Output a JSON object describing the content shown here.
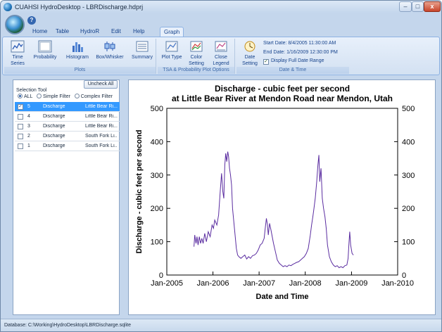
{
  "window": {
    "title": "CUAHSI HydroDesktop - LBRDischarge.hdprj"
  },
  "titlebar_buttons": {
    "minimize": "–",
    "maximize": "□",
    "close": "x"
  },
  "quick_access": {
    "help": "?"
  },
  "tabs": [
    {
      "label": "Home"
    },
    {
      "label": "Table"
    },
    {
      "label": "HydroR"
    },
    {
      "label": "Edit"
    },
    {
      "label": "Help"
    },
    {
      "label": "Graph",
      "active": true
    }
  ],
  "ribbon": {
    "plots_group": {
      "label": "Plots",
      "buttons": [
        {
          "label": "Time Series",
          "icon": "time-series-icon"
        },
        {
          "label": "Probability",
          "icon": "probability-icon"
        },
        {
          "label": "Histogram",
          "icon": "histogram-icon"
        },
        {
          "label": "Box/Whisker",
          "icon": "box-whisker-icon"
        },
        {
          "label": "Summary",
          "icon": "summary-icon"
        }
      ]
    },
    "options_group": {
      "label": "TSA & Probability Plot Options",
      "buttons": [
        {
          "label": "Plot Type",
          "icon": "plot-type-icon"
        },
        {
          "label": "Color Setting",
          "icon": "color-setting-icon"
        },
        {
          "label": "Close Legend",
          "icon": "close-legend-icon"
        }
      ]
    },
    "date_group": {
      "label": "Date & Time",
      "button": {
        "label": "Date Setting",
        "icon": "date-setting-icon"
      },
      "start_date": "Start Date: 8/4/2005 11:30:00 AM",
      "end_date": "End Date:  1/16/2009 12:30:00 PM",
      "display_full_range": "Display Full Date Range",
      "display_full_checked": true
    }
  },
  "left_panel": {
    "uncheck_all": "Uncheck All",
    "selection_tool": "Selection Tool",
    "filters": {
      "all": "ALL",
      "simple": "Simple Filter",
      "complex": "Complex Filter",
      "selected": "all"
    },
    "rows": [
      {
        "id": "5",
        "variable": "Discharge",
        "site": "Little Bear Ri...",
        "checked": true,
        "selected": true
      },
      {
        "id": "4",
        "variable": "Discharge",
        "site": "Little Bear Ri...",
        "checked": false,
        "selected": false
      },
      {
        "id": "3",
        "variable": "Discharge",
        "site": "Little Bear Ri...",
        "checked": false,
        "selected": false
      },
      {
        "id": "2",
        "variable": "Discharge",
        "site": "South Fork Li...",
        "checked": false,
        "selected": false
      },
      {
        "id": "1",
        "variable": "Discharge",
        "site": "South Fork Li...",
        "checked": false,
        "selected": false
      }
    ]
  },
  "chart_data": {
    "type": "line",
    "title": "Discharge - cubic feet per second",
    "subtitle": "at Little Bear River at Mendon Road near Mendon, Utah",
    "xlabel": "Date and Time",
    "ylabel": "Discharge - cubic feet per second",
    "ylim": [
      0,
      500
    ],
    "yticks": [
      0,
      100,
      200,
      300,
      400,
      500
    ],
    "xlim": [
      "2005-01-01",
      "2010-01-01"
    ],
    "xticks": [
      "Jan-2005",
      "Jan-2006",
      "Jan-2007",
      "Jan-2008",
      "Jan-2009",
      "Jan-2010"
    ],
    "line_color": "#5a2ca0",
    "series": [
      {
        "points": [
          [
            "2005-08-04",
            85
          ],
          [
            "2005-08-10",
            120
          ],
          [
            "2005-08-20",
            95
          ],
          [
            "2005-08-28",
            115
          ],
          [
            "2005-09-05",
            90
          ],
          [
            "2005-09-15",
            115
          ],
          [
            "2005-09-25",
            95
          ],
          [
            "2005-10-05",
            110
          ],
          [
            "2005-10-15",
            95
          ],
          [
            "2005-10-28",
            125
          ],
          [
            "2005-11-10",
            100
          ],
          [
            "2005-11-25",
            130
          ],
          [
            "2005-12-10",
            115
          ],
          [
            "2005-12-25",
            150
          ],
          [
            "2006-01-05",
            140
          ],
          [
            "2006-01-15",
            165
          ],
          [
            "2006-02-01",
            150
          ],
          [
            "2006-02-15",
            180
          ],
          [
            "2006-03-01",
            260
          ],
          [
            "2006-03-10",
            305
          ],
          [
            "2006-03-20",
            250
          ],
          [
            "2006-03-28",
            230
          ],
          [
            "2006-04-05",
            330
          ],
          [
            "2006-04-12",
            365
          ],
          [
            "2006-04-20",
            340
          ],
          [
            "2006-04-28",
            370
          ],
          [
            "2006-05-05",
            355
          ],
          [
            "2006-05-12",
            320
          ],
          [
            "2006-05-20",
            300
          ],
          [
            "2006-05-28",
            270
          ],
          [
            "2006-06-05",
            200
          ],
          [
            "2006-06-15",
            160
          ],
          [
            "2006-06-25",
            120
          ],
          [
            "2006-07-05",
            80
          ],
          [
            "2006-07-15",
            60
          ],
          [
            "2006-07-25",
            55
          ],
          [
            "2006-08-10",
            50
          ],
          [
            "2006-08-25",
            55
          ],
          [
            "2006-09-10",
            60
          ],
          [
            "2006-09-25",
            48
          ],
          [
            "2006-10-10",
            55
          ],
          [
            "2006-10-25",
            50
          ],
          [
            "2006-11-10",
            58
          ],
          [
            "2006-11-25",
            60
          ],
          [
            "2006-12-10",
            65
          ],
          [
            "2006-12-25",
            75
          ],
          [
            "2007-01-10",
            90
          ],
          [
            "2007-01-25",
            95
          ],
          [
            "2007-02-10",
            110
          ],
          [
            "2007-02-20",
            145
          ],
          [
            "2007-02-28",
            170
          ],
          [
            "2007-03-08",
            150
          ],
          [
            "2007-03-15",
            120
          ],
          [
            "2007-03-25",
            155
          ],
          [
            "2007-04-05",
            135
          ],
          [
            "2007-04-15",
            115
          ],
          [
            "2007-04-25",
            95
          ],
          [
            "2007-05-10",
            70
          ],
          [
            "2007-05-25",
            45
          ],
          [
            "2007-06-10",
            35
          ],
          [
            "2007-06-25",
            30
          ],
          [
            "2007-07-10",
            25
          ],
          [
            "2007-07-25",
            28
          ],
          [
            "2007-08-10",
            25
          ],
          [
            "2007-08-25",
            30
          ],
          [
            "2007-09-10",
            28
          ],
          [
            "2007-09-25",
            32
          ],
          [
            "2007-10-10",
            35
          ],
          [
            "2007-10-25",
            38
          ],
          [
            "2007-11-10",
            40
          ],
          [
            "2007-11-25",
            45
          ],
          [
            "2007-12-10",
            50
          ],
          [
            "2007-12-25",
            55
          ],
          [
            "2008-01-10",
            65
          ],
          [
            "2008-01-25",
            80
          ],
          [
            "2008-02-10",
            120
          ],
          [
            "2008-02-20",
            150
          ],
          [
            "2008-03-01",
            175
          ],
          [
            "2008-03-10",
            200
          ],
          [
            "2008-03-20",
            230
          ],
          [
            "2008-04-01",
            280
          ],
          [
            "2008-04-10",
            330
          ],
          [
            "2008-04-18",
            360
          ],
          [
            "2008-04-25",
            280
          ],
          [
            "2008-05-05",
            320
          ],
          [
            "2008-05-15",
            230
          ],
          [
            "2008-05-25",
            200
          ],
          [
            "2008-06-05",
            175
          ],
          [
            "2008-06-15",
            140
          ],
          [
            "2008-06-25",
            90
          ],
          [
            "2008-07-10",
            55
          ],
          [
            "2008-07-25",
            40
          ],
          [
            "2008-08-10",
            30
          ],
          [
            "2008-08-25",
            25
          ],
          [
            "2008-09-10",
            28
          ],
          [
            "2008-09-25",
            22
          ],
          [
            "2008-10-10",
            25
          ],
          [
            "2008-10-25",
            22
          ],
          [
            "2008-11-10",
            28
          ],
          [
            "2008-11-25",
            30
          ],
          [
            "2008-12-05",
            50
          ],
          [
            "2008-12-12",
            95
          ],
          [
            "2008-12-18",
            130
          ],
          [
            "2008-12-25",
            90
          ],
          [
            "2009-01-05",
            65
          ],
          [
            "2009-01-16",
            60
          ]
        ]
      }
    ]
  },
  "status": {
    "text": "Database: C:\\Working\\HydroDesktop\\LBRDischarge.sqlite"
  }
}
